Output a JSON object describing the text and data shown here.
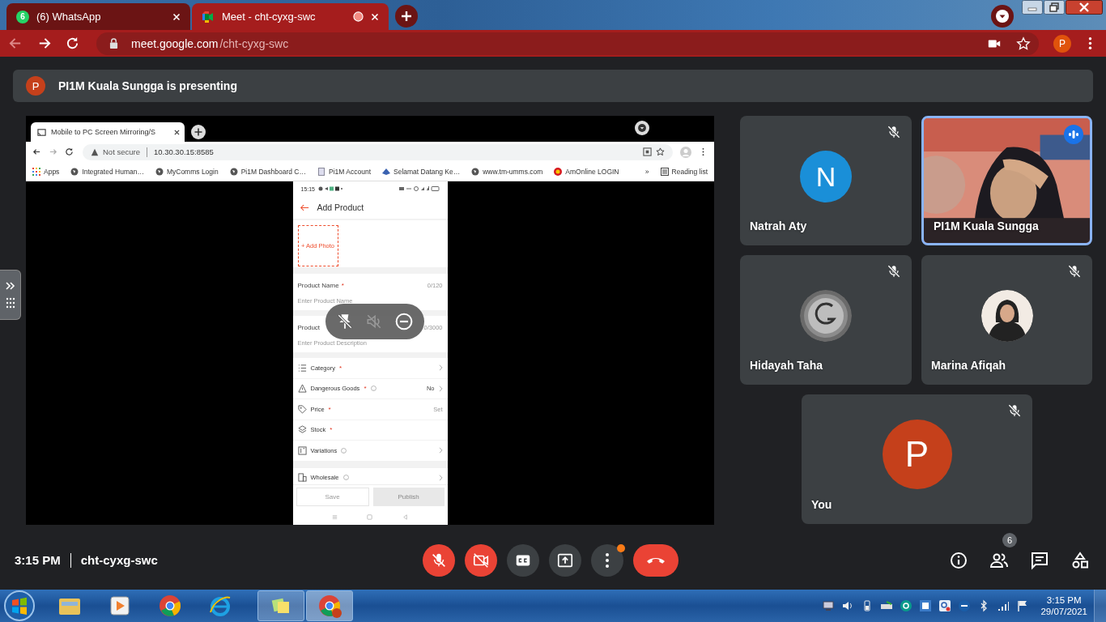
{
  "browser": {
    "tabs": [
      {
        "label": "(6) WhatsApp",
        "badge": "6",
        "kind": "whatsapp",
        "selected": false,
        "recording": false
      },
      {
        "label": "Meet - cht-cyxg-swc",
        "kind": "meet",
        "selected": true,
        "recording": true
      }
    ],
    "url_host": "meet.google.com",
    "url_path": "/cht-cyxg-swc",
    "profile": "P"
  },
  "presenting": {
    "avatar": "P",
    "text": "PI1M Kuala Sungga is presenting"
  },
  "shared_screen": {
    "tab": "Mobile to PC Screen Mirroring/S",
    "security": "Not secure",
    "url": "10.30.30.15:8585",
    "bookmarks": [
      {
        "label": "Apps",
        "kind": "apps"
      },
      {
        "label": "Integrated Human…",
        "kind": "globe"
      },
      {
        "label": "MyComms Login",
        "kind": "globe"
      },
      {
        "label": "Pi1M Dashboard C…",
        "kind": "globe"
      },
      {
        "label": "Pi1M Account",
        "kind": "page"
      },
      {
        "label": "Selamat Datang Ke…",
        "kind": "crest"
      },
      {
        "label": "www.tm-umms.com",
        "kind": "globe"
      },
      {
        "label": "AmOnline LOGIN",
        "kind": "am"
      }
    ],
    "more": "»",
    "reading_list": "Reading list",
    "phone": {
      "time": "15:15",
      "title": "Add Product",
      "add_photo": "+ Add Photo",
      "fields": [
        {
          "label": "Product Name",
          "mark": "*",
          "counter": "0/120",
          "placeholder": "Enter Product Name"
        },
        {
          "label": "Product",
          "counter": "0/3000",
          "placeholder": "Enter Product Description"
        }
      ],
      "rows": [
        {
          "kind": "list",
          "label": "Category",
          "mark": "*",
          "help": false,
          "value": ""
        },
        {
          "kind": "warning",
          "label": "Dangerous Goods",
          "mark": "*",
          "help": true,
          "value": "No"
        },
        {
          "kind": "tag",
          "label": "Price",
          "mark": "*",
          "help": false,
          "value": "Set"
        },
        {
          "kind": "layers",
          "label": "Stock",
          "mark": "*",
          "help": false,
          "value": ""
        },
        {
          "kind": "variations",
          "label": "Variations",
          "help": true,
          "value": ""
        }
      ],
      "last_row": {
        "kind": "wholesale",
        "label": "Wholesale",
        "help": true
      },
      "buttons": [
        "Save",
        "Publish"
      ]
    }
  },
  "participants": [
    {
      "name": "Natrah Aty",
      "kind": "initial",
      "avatar": "N",
      "color": "#1a8fd8",
      "muted": true,
      "speaking": false
    },
    {
      "name": "PI1M Kuala Sungga",
      "kind": "video",
      "muted": false,
      "speaking": true
    },
    {
      "name": "Hidayah Taha",
      "kind": "logo",
      "muted": true,
      "speaking": false
    },
    {
      "name": "Marina Afiqah",
      "muted": true,
      "speaking": false
    },
    {
      "name": "You",
      "kind": "initial",
      "avatar": "P",
      "color": "#c5401b",
      "muted": true,
      "speaking": false
    }
  ],
  "meeting": {
    "time": "3:15 PM",
    "code": "cht-cyxg-swc",
    "mic_on": false,
    "camera_on": false,
    "more_notification": true,
    "participant_count": "6"
  },
  "taskbar": {
    "time": "3:15 PM",
    "date": "29/07/2021"
  }
}
